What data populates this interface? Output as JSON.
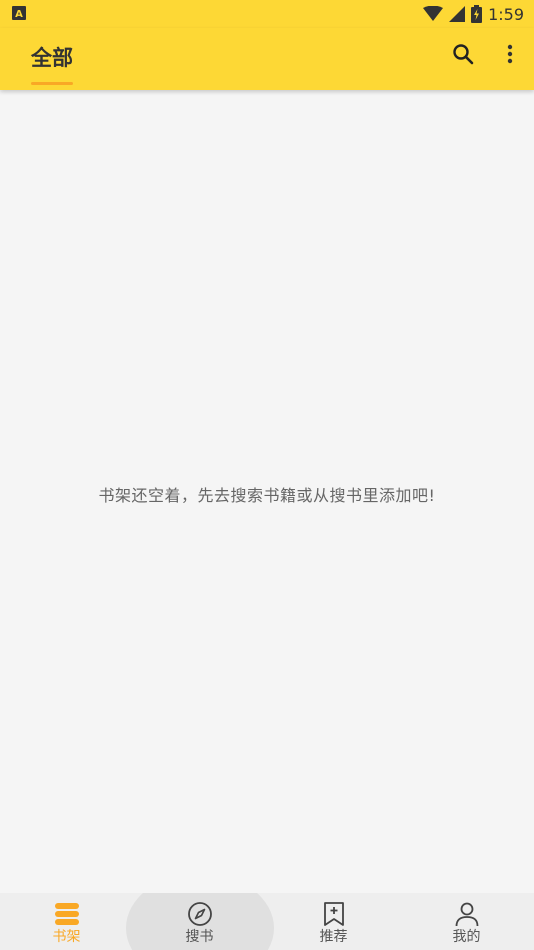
{
  "status_bar": {
    "time": "1:59",
    "left_icon": "a-badge-icon"
  },
  "app_bar": {
    "tab_label": "全部",
    "icons": [
      "search-icon",
      "more-vert-icon"
    ]
  },
  "main": {
    "empty_message": "书架还空着，先去搜索书籍或从搜书里添加吧!"
  },
  "bottom_nav": {
    "items": [
      {
        "label": "书架",
        "icon": "bookshelf-icon",
        "active": true
      },
      {
        "label": "搜书",
        "icon": "compass-icon",
        "active": false
      },
      {
        "label": "推荐",
        "icon": "bookmark-add-icon",
        "active": false
      },
      {
        "label": "我的",
        "icon": "person-icon",
        "active": false
      }
    ]
  },
  "colors": {
    "primary": "#fdd835",
    "accent": "#f9a825",
    "background": "#f5f5f5",
    "nav_background": "#eeeeee"
  }
}
